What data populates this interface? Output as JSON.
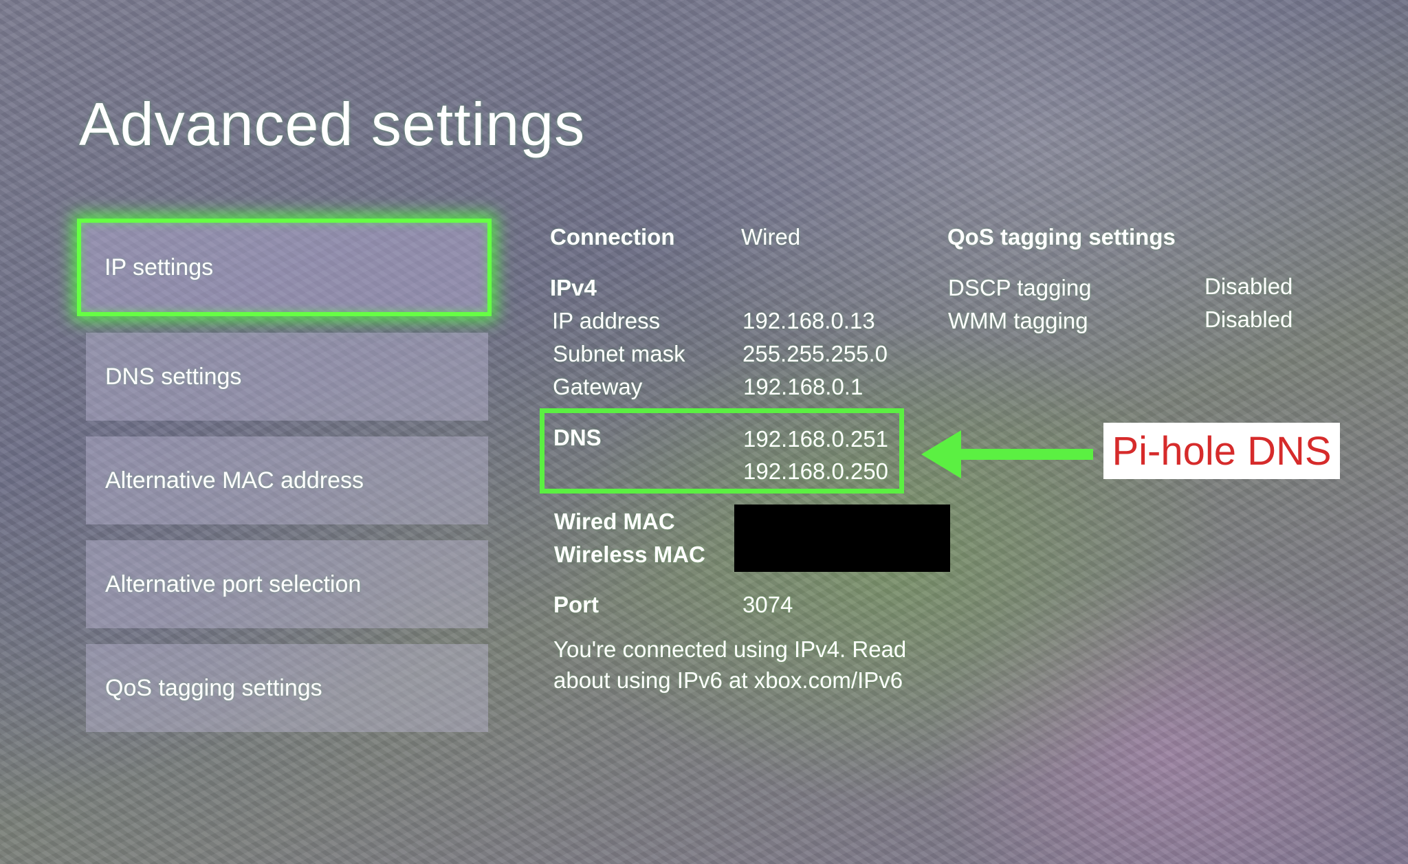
{
  "page_title": "Advanced settings",
  "menu": {
    "items": [
      {
        "label": "IP settings",
        "selected": true
      },
      {
        "label": "DNS settings",
        "selected": false
      },
      {
        "label": "Alternative MAC address",
        "selected": false
      },
      {
        "label": "Alternative port selection",
        "selected": false
      },
      {
        "label": "QoS tagging settings",
        "selected": false
      }
    ]
  },
  "connection": {
    "label": "Connection",
    "value": "Wired"
  },
  "ipv4": {
    "heading": "IPv4",
    "ip_address": {
      "label": "IP address",
      "value": "192.168.0.13"
    },
    "subnet_mask": {
      "label": "Subnet mask",
      "value": "255.255.255.0"
    },
    "gateway": {
      "label": "Gateway",
      "value": "192.168.0.1"
    }
  },
  "dns": {
    "label": "DNS",
    "primary": "192.168.0.251",
    "secondary": "192.168.0.250"
  },
  "mac": {
    "wired_label": "Wired MAC",
    "wireless_label": "Wireless MAC"
  },
  "port": {
    "label": "Port",
    "value": "3074"
  },
  "note": "You're connected using IPv4. Read about using IPv6 at xbox.com/IPv6",
  "qos": {
    "heading": "QoS tagging settings",
    "dscp": {
      "label": "DSCP tagging",
      "value": "Disabled"
    },
    "wmm": {
      "label": "WMM tagging",
      "value": "Disabled"
    }
  },
  "annotation": {
    "text": "Pi-hole DNS",
    "arrow_icon": "left-arrow-icon"
  },
  "colors": {
    "highlight_green": "#5bf042",
    "annotation_red": "#d62b2b",
    "annotation_bg": "#ffffff",
    "redaction": "#000000"
  }
}
